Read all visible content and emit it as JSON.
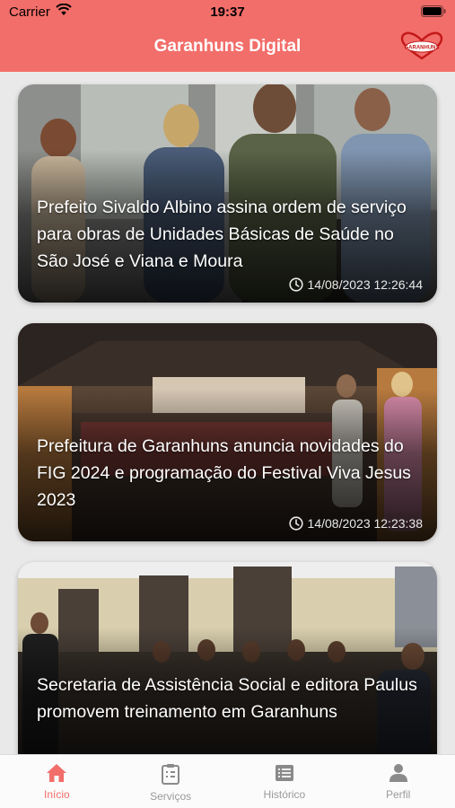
{
  "status_bar": {
    "carrier": "Carrier",
    "time": "19:37"
  },
  "header": {
    "title": "Garanhuns Digital",
    "logo_text": "GARANHUNS"
  },
  "colors": {
    "brand": "#f26e6a",
    "tab_inactive": "#9a9a9a"
  },
  "news": [
    {
      "title": "Prefeito Sivaldo Albino assina ordem de serviço para obras de Unidades Básicas de Saúde no São José e Viana e Moura",
      "date": "14/08/2023 12:26:44"
    },
    {
      "title": "Prefeitura de Garanhuns anuncia novidades do FIG 2024 e programação do Festival Viva Jesus 2023",
      "date": "14/08/2023 12:23:38"
    },
    {
      "title": "Secretaria de Assistência Social e editora Paulus promovem treinamento em Garanhuns",
      "date": ""
    }
  ],
  "tabs": [
    {
      "label": "Início",
      "icon": "home-icon",
      "active": true
    },
    {
      "label": "Serviços",
      "icon": "clipboard-icon",
      "active": false
    },
    {
      "label": "Histórico",
      "icon": "list-icon",
      "active": false
    },
    {
      "label": "Perfil",
      "icon": "person-icon",
      "active": false
    }
  ]
}
